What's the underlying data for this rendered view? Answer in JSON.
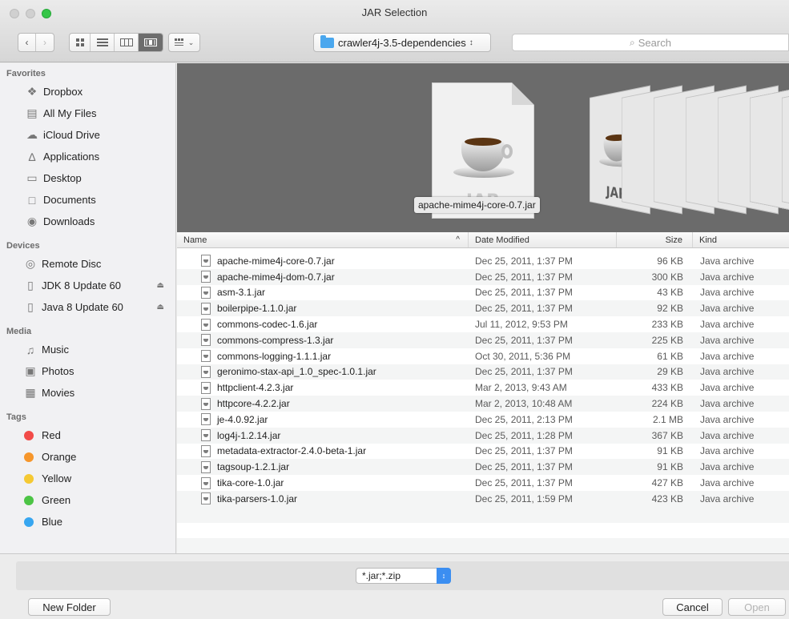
{
  "window": {
    "title": "JAR Selection"
  },
  "toolbar": {
    "back_icon": "chevron-left-icon",
    "forward_icon": "chevron-right-icon",
    "view_modes": [
      "icon-view-icon",
      "list-view-icon",
      "column-view-icon",
      "coverflow-view-icon"
    ],
    "arrange_icon": "arrange-icon",
    "path": "crawler4j-3.5-dependencies",
    "search_placeholder": "Search"
  },
  "sidebar": {
    "favorites_header": "Favorites",
    "favorites": [
      {
        "label": "Dropbox",
        "icon": "dropbox-icon"
      },
      {
        "label": "All My Files",
        "icon": "all-files-icon"
      },
      {
        "label": "iCloud Drive",
        "icon": "cloud-icon"
      },
      {
        "label": "Applications",
        "icon": "applications-icon"
      },
      {
        "label": "Desktop",
        "icon": "desktop-icon"
      },
      {
        "label": "Documents",
        "icon": "documents-icon"
      },
      {
        "label": "Downloads",
        "icon": "downloads-icon"
      }
    ],
    "devices_header": "Devices",
    "devices": [
      {
        "label": "Remote Disc",
        "icon": "disc-icon"
      },
      {
        "label": "JDK 8 Update 60",
        "icon": "drive-icon"
      },
      {
        "label": "Java 8 Update 60",
        "icon": "drive-icon"
      }
    ],
    "media_header": "Media",
    "media": [
      {
        "label": "Music",
        "icon": "music-icon"
      },
      {
        "label": "Photos",
        "icon": "camera-icon"
      },
      {
        "label": "Movies",
        "icon": "film-icon"
      }
    ],
    "tags_header": "Tags",
    "tags": [
      {
        "label": "Red",
        "color": "#f24b48"
      },
      {
        "label": "Orange",
        "color": "#f6962b"
      },
      {
        "label": "Yellow",
        "color": "#f5c933"
      },
      {
        "label": "Green",
        "color": "#4cc445"
      },
      {
        "label": "Blue",
        "color": "#37a6f0"
      }
    ]
  },
  "preview": {
    "selected_name": "apache-mime4j-core-0.7.jar",
    "jar_text": "JAR"
  },
  "list": {
    "headers": {
      "name": "Name",
      "date": "Date Modified",
      "size": "Size",
      "kind": "Kind"
    },
    "sort_indicator": "^",
    "rows": [
      {
        "name": "apache-mime4j-core-0.7.jar",
        "date": "Dec 25, 2011, 1:37 PM",
        "size": "96 KB",
        "kind": "Java archive"
      },
      {
        "name": "apache-mime4j-dom-0.7.jar",
        "date": "Dec 25, 2011, 1:37 PM",
        "size": "300 KB",
        "kind": "Java archive"
      },
      {
        "name": "asm-3.1.jar",
        "date": "Dec 25, 2011, 1:37 PM",
        "size": "43 KB",
        "kind": "Java archive"
      },
      {
        "name": "boilerpipe-1.1.0.jar",
        "date": "Dec 25, 2011, 1:37 PM",
        "size": "92 KB",
        "kind": "Java archive"
      },
      {
        "name": "commons-codec-1.6.jar",
        "date": "Jul 11, 2012, 9:53 PM",
        "size": "233 KB",
        "kind": "Java archive"
      },
      {
        "name": "commons-compress-1.3.jar",
        "date": "Dec 25, 2011, 1:37 PM",
        "size": "225 KB",
        "kind": "Java archive"
      },
      {
        "name": "commons-logging-1.1.1.jar",
        "date": "Oct 30, 2011, 5:36 PM",
        "size": "61 KB",
        "kind": "Java archive"
      },
      {
        "name": "geronimo-stax-api_1.0_spec-1.0.1.jar",
        "date": "Dec 25, 2011, 1:37 PM",
        "size": "29 KB",
        "kind": "Java archive"
      },
      {
        "name": "httpclient-4.2.3.jar",
        "date": "Mar 2, 2013, 9:43 AM",
        "size": "433 KB",
        "kind": "Java archive"
      },
      {
        "name": "httpcore-4.2.2.jar",
        "date": "Mar 2, 2013, 10:48 AM",
        "size": "224 KB",
        "kind": "Java archive"
      },
      {
        "name": "je-4.0.92.jar",
        "date": "Dec 25, 2011, 2:13 PM",
        "size": "2.1 MB",
        "kind": "Java archive"
      },
      {
        "name": "log4j-1.2.14.jar",
        "date": "Dec 25, 2011, 1:28 PM",
        "size": "367 KB",
        "kind": "Java archive"
      },
      {
        "name": "metadata-extractor-2.4.0-beta-1.jar",
        "date": "Dec 25, 2011, 1:37 PM",
        "size": "91 KB",
        "kind": "Java archive"
      },
      {
        "name": "tagsoup-1.2.1.jar",
        "date": "Dec 25, 2011, 1:37 PM",
        "size": "91 KB",
        "kind": "Java archive"
      },
      {
        "name": "tika-core-1.0.jar",
        "date": "Dec 25, 2011, 1:37 PM",
        "size": "427 KB",
        "kind": "Java archive"
      },
      {
        "name": "tika-parsers-1.0.jar",
        "date": "Dec 25, 2011, 1:59 PM",
        "size": "423 KB",
        "kind": "Java archive"
      }
    ]
  },
  "footer": {
    "filter_value": "*.jar;*.zip",
    "new_folder": "New Folder",
    "cancel": "Cancel",
    "open": "Open"
  }
}
